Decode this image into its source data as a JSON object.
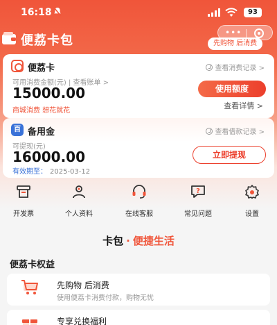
{
  "status": {
    "time": "16:18",
    "battery": "93"
  },
  "header": {
    "app_title": "便荔卡包",
    "slogan": "先购物 后消费"
  },
  "card1": {
    "title": "便荔卡",
    "record_link": "查看消费记录 >",
    "label": "可用消费金额(元) | 查看账单 >",
    "amount": "15000.00",
    "tags": "商城消费 想花就花",
    "button": "使用额度",
    "detail": "查看详情 >"
  },
  "card2": {
    "icon_text": "百",
    "title": "备用金",
    "record_link": "查看借款记录 >",
    "label": "可提现(元)",
    "amount": "16000.00",
    "valid_label": "有效期至：",
    "valid_date": "2025-03-12",
    "button": "立即提现"
  },
  "grid": [
    {
      "label": "开发票",
      "icon": "invoice-icon"
    },
    {
      "label": "个人资料",
      "icon": "profile-icon"
    },
    {
      "label": "在线客服",
      "icon": "headset-icon"
    },
    {
      "label": "常见问题",
      "icon": "faq-icon"
    },
    {
      "label": "设置",
      "icon": "gear-icon"
    }
  ],
  "banner": {
    "part1": "卡包",
    "dot": "·",
    "part2": "便捷生活"
  },
  "benefits": {
    "title": "便荔卡权益",
    "items": [
      {
        "title": "先购物 后消费",
        "desc": "使用便荔卡消费付款，购物无忧",
        "icon": "cart-icon"
      },
      {
        "title": "专享兑换福利",
        "desc": "",
        "icon": "gift-icon"
      }
    ]
  },
  "colors": {
    "brand": "#f0553a",
    "accent_blue": "#3a72d8"
  }
}
